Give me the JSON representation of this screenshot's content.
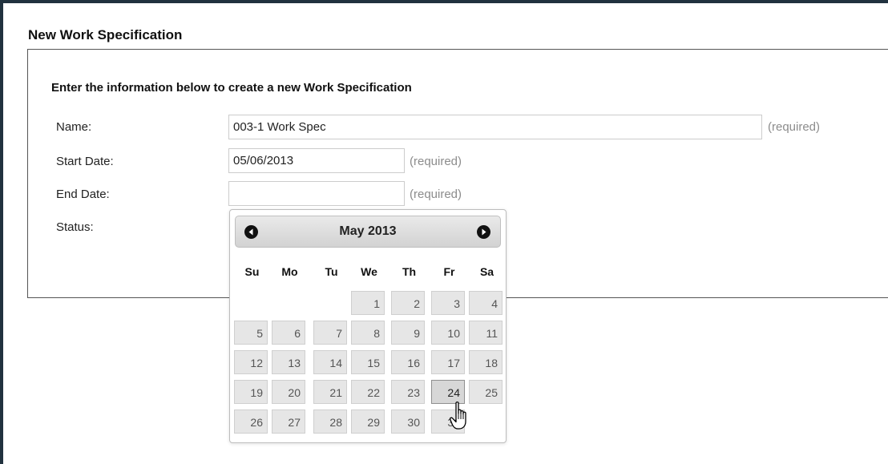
{
  "page": {
    "title": "New Work Specification",
    "instructions": "Enter the information below to create a new Work Specification"
  },
  "form": {
    "name": {
      "label": "Name:",
      "value": "003-1 Work Spec",
      "note": "(required)"
    },
    "start_date": {
      "label": "Start Date:",
      "value": "05/06/2013",
      "note": "(required)"
    },
    "end_date": {
      "label": "End Date:",
      "value": "",
      "note": "(required)"
    },
    "status": {
      "label": "Status:"
    }
  },
  "datepicker": {
    "month_label": "May 2013",
    "prev_icon": "circle-arrow-left-icon",
    "next_icon": "circle-arrow-right-icon",
    "weekdays": [
      "Su",
      "Mo",
      "Tu",
      "We",
      "Th",
      "Fr",
      "Sa"
    ],
    "weeks": [
      [
        "",
        "",
        "",
        "1",
        "2",
        "3",
        "4"
      ],
      [
        "5",
        "6",
        "7",
        "8",
        "9",
        "10",
        "11"
      ],
      [
        "12",
        "13",
        "14",
        "15",
        "16",
        "17",
        "18"
      ],
      [
        "19",
        "20",
        "21",
        "22",
        "23",
        "24",
        "25"
      ],
      [
        "26",
        "27",
        "28",
        "29",
        "30",
        "31",
        ""
      ]
    ],
    "hovered_day": "24"
  },
  "cursor": {
    "icon": "hand-pointer-icon"
  },
  "colors": {
    "frame_border": "#21323f",
    "panel_border": "#555555",
    "day_cell": "#e6e6e6",
    "day_cell_hover": "#d7d7d7",
    "required_text": "#8c8c8c"
  }
}
